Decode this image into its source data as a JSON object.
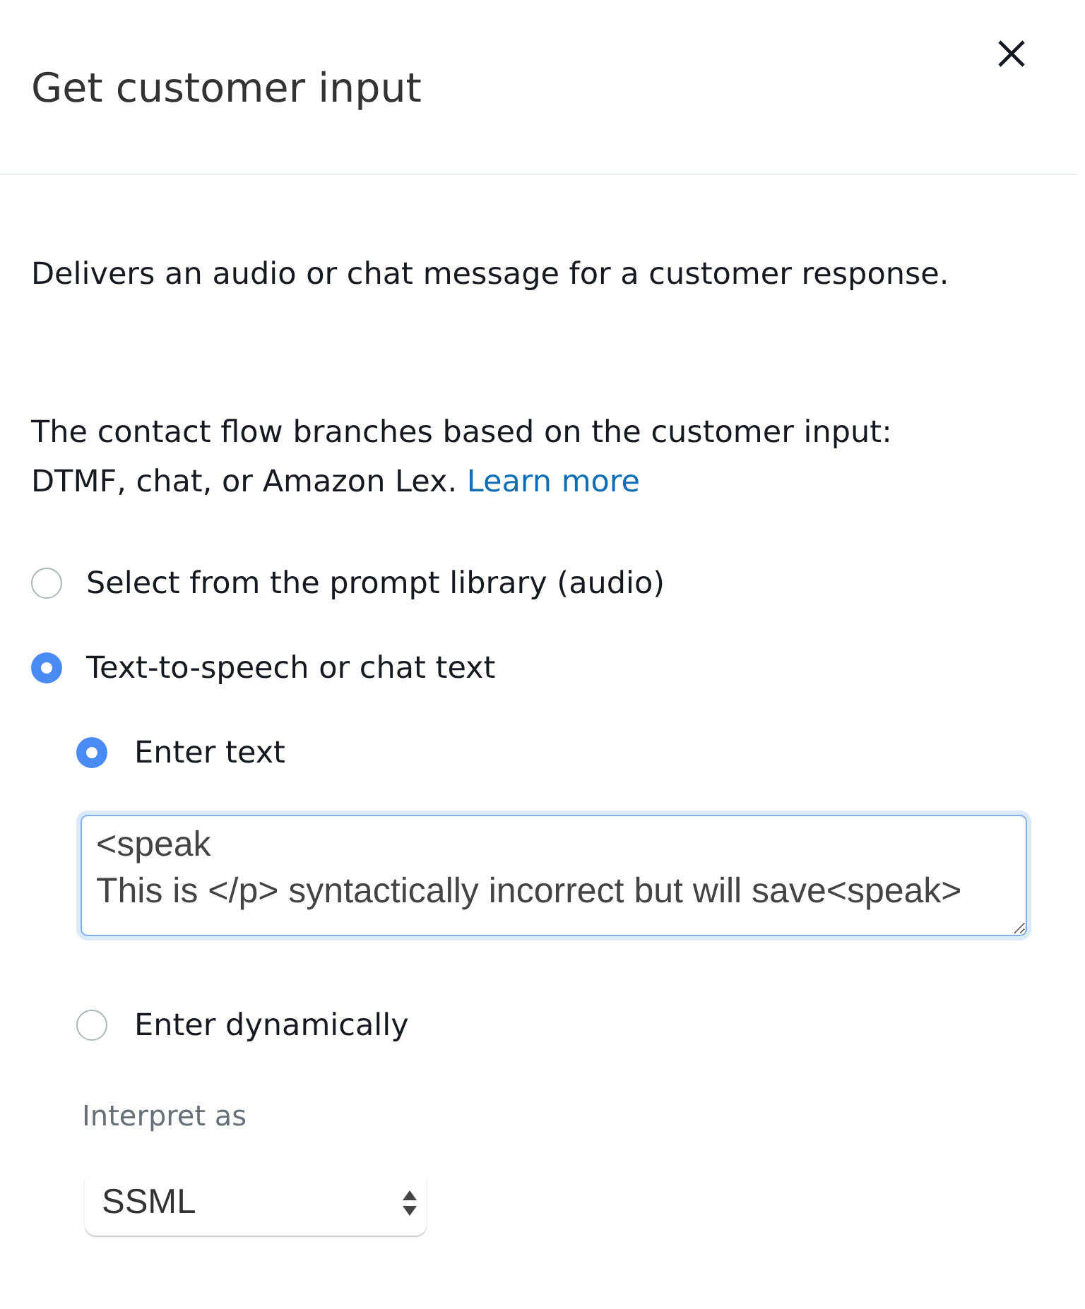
{
  "panel": {
    "title": "Get customer input"
  },
  "description": "Delivers an audio or chat message for a customer response.",
  "branch_info": {
    "text": "The contact flow branches based on the customer input: DTMF, chat, or Amazon Lex.",
    "link": "Learn more"
  },
  "prompt_source": [
    {
      "label": "Select from the prompt library (audio)",
      "selected": false
    },
    {
      "label": "Text-to-speech or chat text",
      "selected": true
    }
  ],
  "text_source": [
    {
      "label": "Enter text",
      "selected": true,
      "text_field": {
        "value": "<speak\nThis is </p> syntactically incorrect but will save<speak>",
        "focused": true
      }
    },
    {
      "label": "Enter dynamically",
      "selected": false
    }
  ],
  "interpret_as": {
    "label": "Interpret as",
    "value": "SSML"
  }
}
